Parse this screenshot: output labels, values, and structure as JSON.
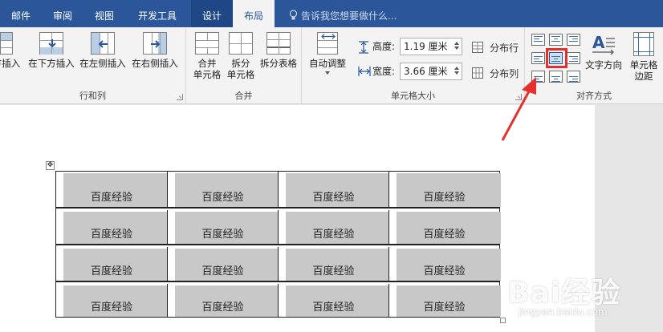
{
  "tabs": [
    {
      "label": "邮件"
    },
    {
      "label": "审阅"
    },
    {
      "label": "视图"
    },
    {
      "label": "开发工具"
    },
    {
      "label": "设计"
    },
    {
      "label": "布局"
    }
  ],
  "tell_me": "告诉我您想要做什么...",
  "groups": {
    "rows_cols": {
      "label": "行和列",
      "buttons": [
        "方插入",
        "在下方插入",
        "在左侧插入",
        "在右侧插入"
      ]
    },
    "merge": {
      "label": "合并",
      "merge_cells": "合并\n单元格",
      "merge_cells_l1": "合并",
      "merge_cells_l2": "单元格",
      "split_cells_l1": "拆分",
      "split_cells_l2": "单元格",
      "split_table": "拆分表格"
    },
    "cell_size": {
      "label": "单元格大小",
      "autofit": "自动调整",
      "height_label": "高度:",
      "height_value": "1.19 厘米",
      "width_label": "宽度:",
      "width_value": "3.66 厘米",
      "distribute_rows": "分布行",
      "distribute_cols": "分布列"
    },
    "alignment": {
      "label": "对齐方式",
      "text_direction": "文字方向",
      "cell_margins_l1": "单元格",
      "cell_margins_l2": "边距"
    }
  },
  "table": {
    "rows": [
      [
        "百度经验",
        "百度经验",
        "百度经验",
        "百度经验"
      ],
      [
        "百度经验",
        "百度经验",
        "百度经验",
        "百度经验"
      ],
      [
        "百度经验",
        "百度经验",
        "百度经验",
        "百度经验"
      ],
      [
        "百度经验",
        "百度经验",
        "百度经验",
        "百度经验"
      ]
    ]
  },
  "watermark": {
    "main": "Bai经验",
    "sub": "jingyan.baidu.com"
  },
  "colors": {
    "ribbon_blue": "#2b579a",
    "cell_shade": "#c8c8c8",
    "annotation_red": "#e5302e"
  }
}
